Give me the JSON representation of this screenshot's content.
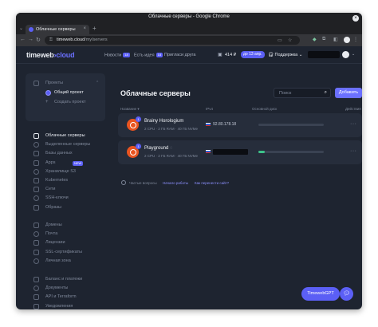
{
  "browser": {
    "window_title": "Облачные серверы - Google Chrome",
    "tab_title": "Облачные серверы",
    "url_host": "timeweb.cloud",
    "url_path": "/my/servers"
  },
  "header": {
    "logo_main": "timeweb",
    "logo_accent": "›cloud",
    "nav": [
      {
        "label": "Новости",
        "badge": "18"
      },
      {
        "label": "Есть идея",
        "badge": "18"
      },
      {
        "label": "Пригласи друга",
        "badge": ""
      }
    ],
    "balance": "414 ₽",
    "days_left": "до 13 апр.",
    "support": "Поддержка"
  },
  "sidebar": {
    "projects_label": "Проекты",
    "default_project": "Общий проект",
    "create_project": "Создать проект",
    "groups": [
      [
        {
          "label": "Облачные серверы",
          "icon": "cloud-icon",
          "active": true,
          "badge": ""
        },
        {
          "label": "Выделенные серверы",
          "icon": "server-icon",
          "active": false,
          "badge": ""
        },
        {
          "label": "Базы данных",
          "icon": "database-icon",
          "active": false,
          "badge": ""
        },
        {
          "label": "Apps",
          "icon": "apps-icon",
          "active": false,
          "badge": "NEW"
        },
        {
          "label": "Хранилище S3",
          "icon": "storage-icon",
          "active": false,
          "badge": ""
        },
        {
          "label": "Kubernetes",
          "icon": "kubernetes-icon",
          "active": false,
          "badge": ""
        },
        {
          "label": "Сети",
          "icon": "network-icon",
          "active": false,
          "badge": ""
        },
        {
          "label": "SSH-ключи",
          "icon": "key-icon",
          "active": false,
          "badge": ""
        },
        {
          "label": "Образы",
          "icon": "image-icon",
          "active": false,
          "badge": ""
        }
      ],
      [
        {
          "label": "Домены",
          "icon": "globe-icon",
          "active": false,
          "badge": ""
        },
        {
          "label": "Почта",
          "icon": "mail-icon",
          "active": false,
          "badge": ""
        },
        {
          "label": "Лицензии",
          "icon": "license-icon",
          "active": false,
          "badge": ""
        },
        {
          "label": "SSL-сертификаты",
          "icon": "shield-icon",
          "active": false,
          "badge": ""
        },
        {
          "label": "Личная зона",
          "icon": "zone-icon",
          "active": false,
          "badge": ""
        }
      ],
      [
        {
          "label": "Баланс и платежи",
          "icon": "wallet-icon",
          "active": false,
          "badge": ""
        },
        {
          "label": "Документы",
          "icon": "document-icon",
          "active": false,
          "badge": ""
        },
        {
          "label": "API и Terraform",
          "icon": "code-icon",
          "active": false,
          "badge": ""
        },
        {
          "label": "Уведомления",
          "icon": "bell-icon",
          "active": false,
          "badge": ""
        },
        {
          "label": "Пользователи",
          "icon": "users-icon",
          "active": false,
          "badge": ""
        }
      ]
    ]
  },
  "main": {
    "title": "Облачные серверы",
    "search_placeholder": "Поиск",
    "add_button": "Добавить",
    "columns": [
      "Название ▾",
      "IPv4",
      "Основной диск",
      "Действия"
    ],
    "servers": [
      {
        "name": "Brainy Horologium",
        "status_icon": "",
        "spec": "2 CPU · 2 ГБ RAM · 40 ГБ NVMe",
        "ip": "92.80.178.18",
        "ip_hidden": false,
        "disk_used": 0.0,
        "os_badge": "1"
      },
      {
        "name": "Playground",
        "status_icon": "◌",
        "spec": "2 CPU · 2 ГБ RAM · 40 ГБ NVMe",
        "ip": "",
        "ip_hidden": true,
        "disk_used": 0.1,
        "os_badge": "1"
      }
    ],
    "faq_label": "Частые вопросы",
    "faq_links": [
      "Начало работы",
      "Как перенести сайт?"
    ]
  },
  "floating": {
    "gpt": "TimewebGPT"
  },
  "colors": {
    "accent": "#5b5ff5",
    "background": "#1e2430",
    "ubuntu": "#e95420",
    "disk_fill": "#3cc28a"
  }
}
